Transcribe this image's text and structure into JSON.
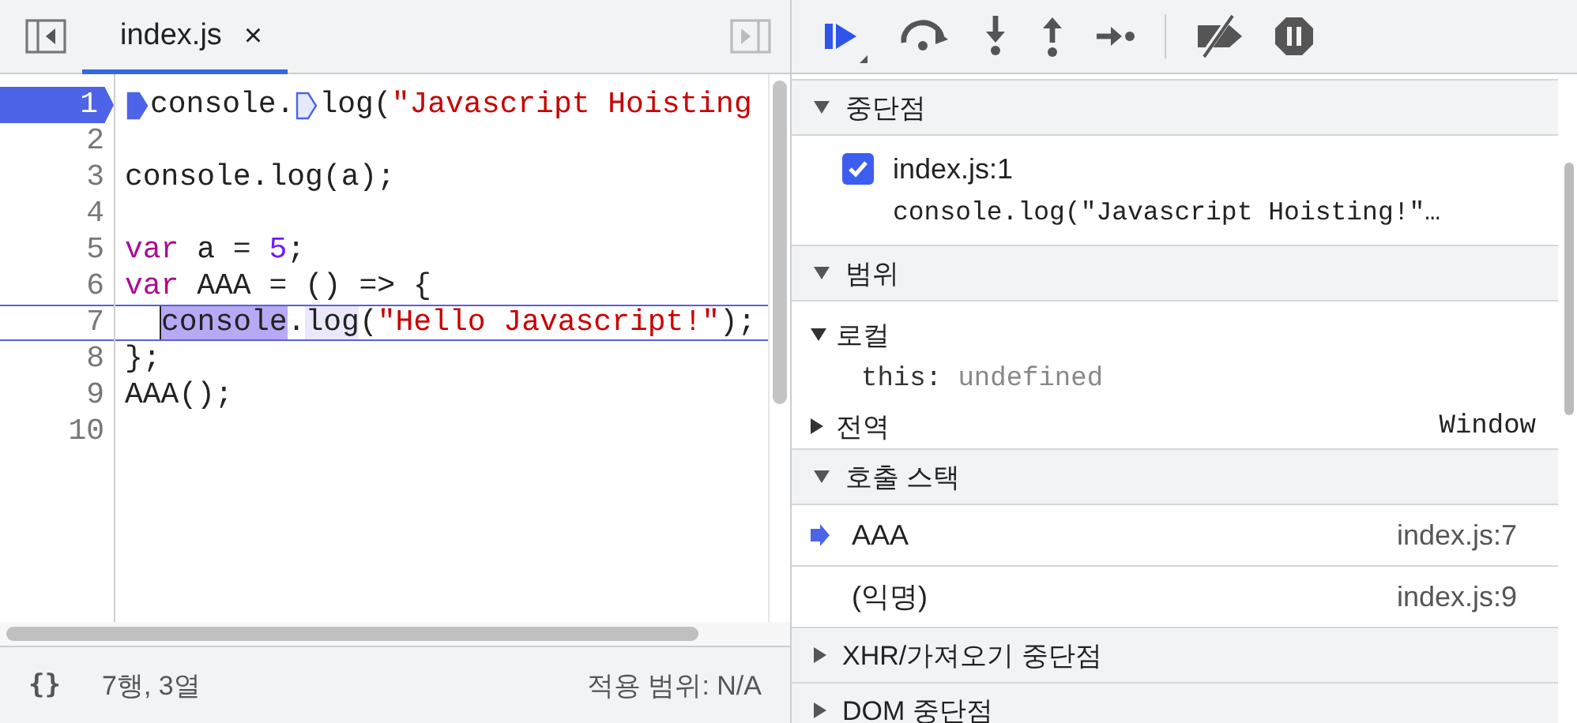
{
  "editor": {
    "tabs": [
      {
        "label": "index.js",
        "close": "×",
        "selected": true
      }
    ],
    "lines": [
      {
        "number": "1",
        "breakpoint": true,
        "tokens": [
          {
            "kind": "marker",
            "active": true
          },
          {
            "kind": "plain",
            "text": "console."
          },
          {
            "kind": "marker",
            "active": false
          },
          {
            "kind": "plain",
            "text": "log("
          },
          {
            "kind": "string",
            "text": "\"Javascript Hoisting"
          }
        ]
      },
      {
        "number": "2"
      },
      {
        "number": "3",
        "tokens": [
          {
            "kind": "plain",
            "text": "console.log(a);"
          }
        ]
      },
      {
        "number": "4"
      },
      {
        "number": "5",
        "tokens": [
          {
            "kind": "keyword",
            "text": "var"
          },
          {
            "kind": "plain",
            "text": " a = "
          },
          {
            "kind": "number",
            "text": "5"
          },
          {
            "kind": "plain",
            "text": ";"
          }
        ]
      },
      {
        "number": "6",
        "tokens": [
          {
            "kind": "keyword",
            "text": "var"
          },
          {
            "kind": "plain",
            "text": " AAA = () => {"
          }
        ]
      },
      {
        "number": "7",
        "current": true,
        "tokens": [
          {
            "kind": "highlight",
            "text": "console"
          },
          {
            "kind": "plain",
            "text": "."
          },
          {
            "kind": "soft-highlight",
            "text": "log"
          },
          {
            "kind": "plain",
            "text": "("
          },
          {
            "kind": "string",
            "text": "\"Hello Javascript!\""
          },
          {
            "kind": "plain",
            "text": ");"
          }
        ]
      },
      {
        "number": "8",
        "tokens": [
          {
            "kind": "plain",
            "text": "};"
          }
        ]
      },
      {
        "number": "9",
        "tokens": [
          {
            "kind": "plain",
            "text": "AAA();"
          }
        ]
      },
      {
        "number": "10"
      }
    ]
  },
  "status_bar": {
    "format": "{}",
    "position": "7행, 3열",
    "coverage": "적용 범위: N/A"
  },
  "debugger": {
    "breakpoints": {
      "title": "중단점",
      "expanded": true,
      "items": [
        {
          "file": "index.js:1",
          "code": "console.log(\"Javascript Hoisting!\"…",
          "checked": true
        }
      ]
    },
    "scope": {
      "title": "범위",
      "expanded": true,
      "items": [
        {
          "name": "로컬",
          "expanded": true,
          "children": [
            {
              "key": "this:",
              "value": "undefined"
            }
          ]
        },
        {
          "name": "전역",
          "expanded": false,
          "value": "Window"
        }
      ]
    },
    "call_stack": {
      "title": "호출 스택",
      "expanded": true,
      "frames": [
        {
          "name": "AAA",
          "location": "index.js:7",
          "selected": true
        },
        {
          "name": "(익명)",
          "location": "index.js:9",
          "selected": false
        }
      ]
    },
    "collapsed_sections": [
      {
        "title": "XHR/가져오기 중단점",
        "expanded": false
      },
      {
        "title": "DOM 중단점",
        "expanded": false
      }
    ]
  }
}
